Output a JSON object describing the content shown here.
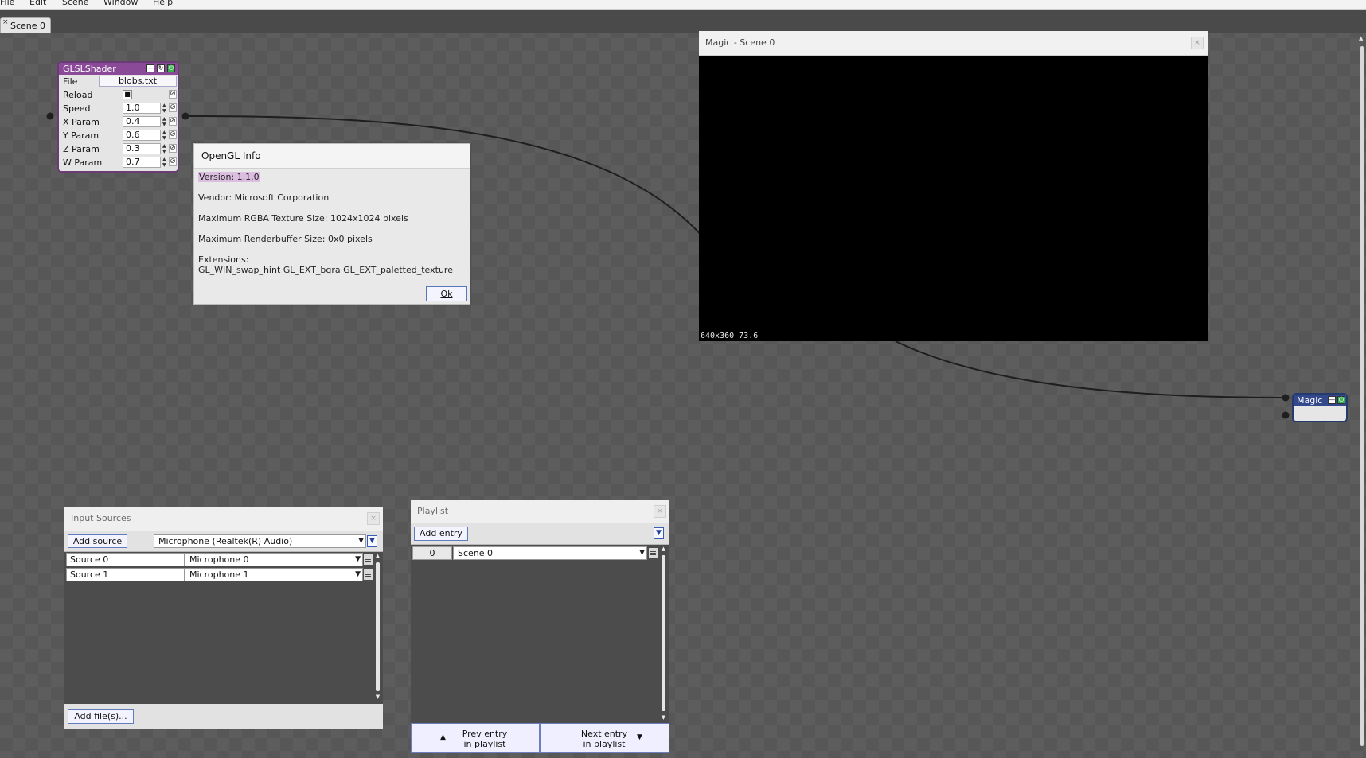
{
  "menu": {
    "items": [
      {
        "label": "File"
      },
      {
        "label": "Edit"
      },
      {
        "label": "Scene"
      },
      {
        "label": "Window"
      },
      {
        "label": "Help"
      }
    ]
  },
  "tabs": {
    "active": "Scene 0",
    "close_glyph": "×"
  },
  "glsl_node": {
    "title": "GLSLShader",
    "file_label": "File",
    "file_value": "blobs.txt",
    "reload_label": "Reload",
    "reload_checked": true,
    "params": [
      {
        "label": "Speed",
        "value": "1.0"
      },
      {
        "label": "X Param",
        "value": "0.4"
      },
      {
        "label": "Y Param",
        "value": "0.6"
      },
      {
        "label": "Z Param",
        "value": "0.3"
      },
      {
        "label": "W Param",
        "value": "0.7"
      }
    ]
  },
  "opengl_dialog": {
    "title": "OpenGL Info",
    "version": "Version: 1.1.0",
    "vendor": "Vendor: Microsoft Corporation",
    "max_texture": "Maximum RGBA Texture Size: 1024x1024 pixels",
    "max_renderbuffer": "Maximum Renderbuffer Size: 0x0 pixels",
    "extensions_label": "Extensions:",
    "extensions_value": "GL_WIN_swap_hint GL_EXT_bgra GL_EXT_paletted_texture",
    "ok_label": "Ok"
  },
  "viewer": {
    "title": "Magic - Scene 0",
    "status": "640x360  73.6"
  },
  "magic_node": {
    "title": "Magic"
  },
  "input_sources": {
    "title": "Input Sources",
    "add_source_label": "Add source",
    "device": "Microphone (Realtek(R) Audio)",
    "rows": [
      {
        "name": "Source 0",
        "input": "Microphone 0"
      },
      {
        "name": "Source 1",
        "input": "Microphone 1"
      }
    ],
    "add_files_label": "Add file(s)..."
  },
  "playlist": {
    "title": "Playlist",
    "add_entry_label": "Add entry",
    "entries": [
      {
        "index": "0",
        "scene": "Scene 0"
      }
    ],
    "prev_label_1": "Prev entry",
    "prev_label_2": "in playlist",
    "next_label_1": "Next entry",
    "next_label_2": "in playlist"
  },
  "colors": {
    "canvas_bg": "#575757",
    "glsl_header": "#8a4a97",
    "magic_header": "#33498c",
    "button_border": "#5f7cbf",
    "wire": "#1e1e1e"
  },
  "icons": {
    "minimize": "minimize-icon",
    "reload": "reload-icon",
    "enable": "power-icon",
    "link": "link-icon",
    "dropdown": "chevron-down-icon",
    "row_menu": "hamburger-icon",
    "prev": "triangle-up-icon",
    "next": "triangle-down-icon"
  }
}
